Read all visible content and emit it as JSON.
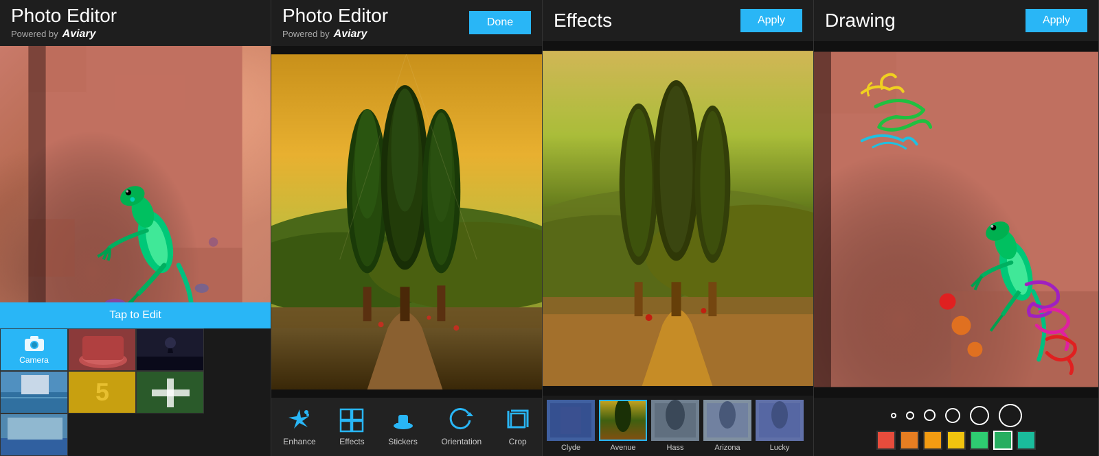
{
  "panel1": {
    "title": "Photo Editor",
    "powered_by": "Powered by",
    "aviary": "Aviary",
    "tap_to_edit": "Tap to Edit",
    "thumbnails": [
      {
        "label": "Camera",
        "type": "camera"
      },
      {
        "label": "shoes",
        "type": "red"
      },
      {
        "label": "silhouette",
        "type": "dark"
      },
      {
        "label": "pool",
        "type": "water"
      },
      {
        "label": "yellow",
        "type": "yellow"
      },
      {
        "label": "plus",
        "type": "green"
      },
      {
        "label": "landscape",
        "type": "water"
      }
    ]
  },
  "panel2": {
    "title": "Photo Editor",
    "powered_by": "Powered by",
    "aviary": "Aviary",
    "done_label": "Done",
    "tools": [
      {
        "id": "enhance",
        "label": "Enhance",
        "icon": "✦"
      },
      {
        "id": "effects",
        "label": "Effects",
        "icon": "▦"
      },
      {
        "id": "stickers",
        "label": "Stickers",
        "icon": "🎩"
      },
      {
        "id": "orientation",
        "label": "Orientation",
        "icon": "↺"
      },
      {
        "id": "crop",
        "label": "Crop",
        "icon": "⊡"
      }
    ]
  },
  "panel3": {
    "title": "Effects",
    "apply_label": "Apply",
    "effects": [
      {
        "id": "clyde",
        "label": "Clyde"
      },
      {
        "id": "avenue",
        "label": "Avenue",
        "selected": true
      },
      {
        "id": "hass",
        "label": "Hass"
      },
      {
        "id": "arizona",
        "label": "Arizona"
      },
      {
        "id": "lucky",
        "label": "Lucky"
      }
    ]
  },
  "panel4": {
    "title": "Drawing",
    "apply_label": "Apply",
    "brush_sizes": [
      4,
      8,
      14,
      20,
      28,
      36
    ],
    "colors": [
      "#e74c3c",
      "#e67e22",
      "#f39c12",
      "#f1c40f",
      "#2ecc71",
      "#27ae60",
      "#1abc9c"
    ]
  }
}
